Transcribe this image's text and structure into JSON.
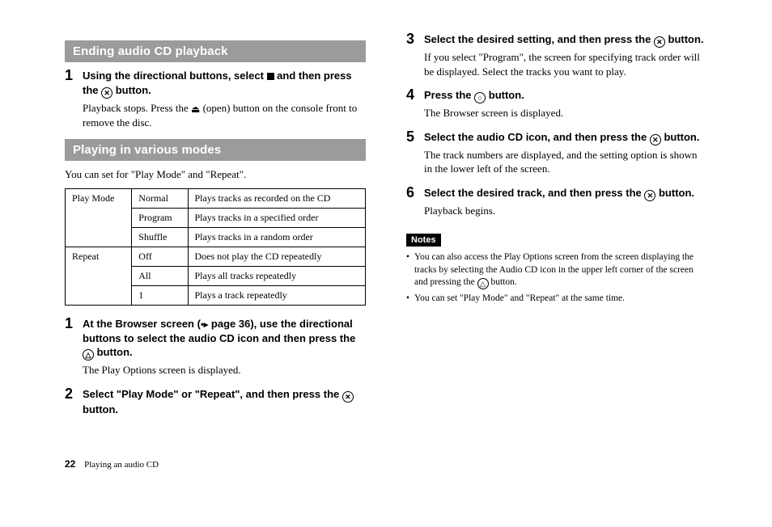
{
  "left": {
    "section1_title": "Ending audio CD playback",
    "step1_head_a": "Using the directional buttons, select ",
    "step1_head_b": " and then press the ",
    "step1_head_c": " button.",
    "step1_body_a": "Playback stops. Press the ",
    "step1_body_b": " (open) button on the console front to remove the disc.",
    "section2_title": "Playing in various modes",
    "intro2": "You can set for \"Play Mode\" and \"Repeat\".",
    "table": {
      "r1c1": "Play Mode",
      "r1c2": "Normal",
      "r1c3": "Plays tracks as recorded on the CD",
      "r2c2": "Program",
      "r2c3": "Plays tracks in a specified order",
      "r3c2": "Shuffle",
      "r3c3": "Plays tracks in a random order",
      "r4c1": "Repeat",
      "r4c2": "Off",
      "r4c3": "Does not play the CD repeatedly",
      "r5c2": "All",
      "r5c3": "Plays all tracks repeatedly",
      "r6c2": "1",
      "r6c3": "Plays a track repeatedly"
    },
    "stepA_head_a": "At the Browser screen (",
    "stepA_head_ref": " page 36), use the directional buttons to select the audio CD icon and then press the ",
    "stepA_head_b": " button.",
    "stepA_body": "The Play Options screen is displayed.",
    "stepB_head_a": "Select \"Play Mode\" or \"Repeat\", and then press the ",
    "stepB_head_b": " button."
  },
  "right": {
    "step3_head_a": "Select the desired setting, and then press the ",
    "step3_head_b": " button.",
    "step3_body": "If you select \"Program\", the screen for specifying track order will be displayed. Select the tracks you want to play.",
    "step4_head_a": "Press the ",
    "step4_head_b": " button.",
    "step4_body": "The Browser screen is displayed.",
    "step5_head_a": "Select the audio CD icon, and then press the ",
    "step5_head_b": " button.",
    "step5_body": "The track numbers are displayed, and the setting option is shown in the lower left of the screen.",
    "step6_head_a": "Select the desired track, and then press the ",
    "step6_head_b": " button.",
    "step6_body": "Playback begins.",
    "notes_label": "Notes",
    "note1_a": "You can also access the Play Options screen from the screen displaying the tracks by selecting the Audio CD icon in the upper left corner of the screen and pressing the ",
    "note1_b": " button.",
    "note2": "You can set \"Play Mode\" and \"Repeat\" at the same time."
  },
  "footer": {
    "page": "22",
    "title": "Playing an audio CD"
  },
  "glyph": {
    "x": "✕",
    "circle": "○",
    "triangle": "△",
    "eject": "⏏",
    "ref": "•▸"
  }
}
